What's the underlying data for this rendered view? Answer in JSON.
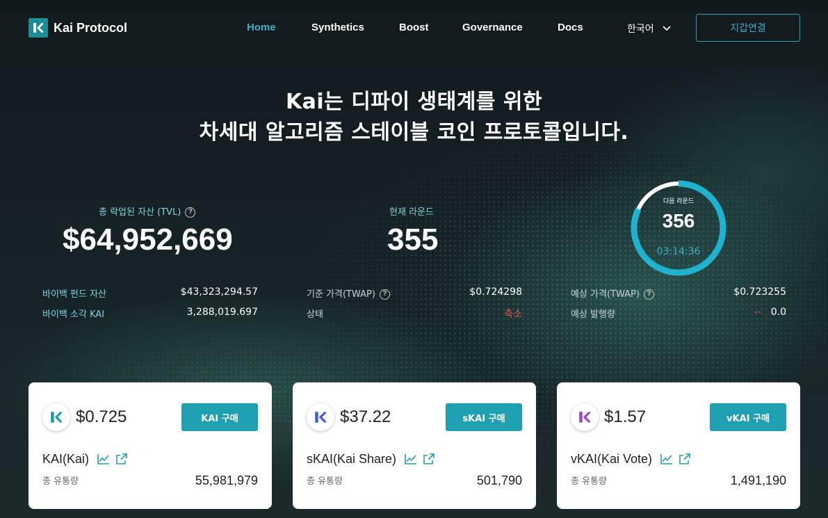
{
  "header": {
    "brand": "Kai Protocol",
    "nav": [
      "Home",
      "Synthetics",
      "Boost",
      "Governance",
      "Docs"
    ],
    "active_nav": "Home",
    "language": "한국어",
    "connect_label": "지갑연결"
  },
  "hero": {
    "line1": "Kai는 디파이 생태계를 위한",
    "line2": "차세대 알고리즘 스테이블 코인 프로토콜입니다."
  },
  "stats": {
    "tvl_label": "총 락업된 자산 (TVL)",
    "tvl_value": "$64,952,669",
    "round_label": "현재 라운드",
    "round_value": "355",
    "next_round_label": "다음 라운드",
    "next_round_value": "356",
    "next_round_timer": "03:14:36",
    "next_round_progress": 0.82
  },
  "details": {
    "buyback_fund_label": "바이백 펀드 자산",
    "buyback_fund_value": "$43,323,294.57",
    "buyback_burn_label": "바이백 소각 KAI",
    "buyback_burn_value": "3,288,019.697",
    "twap_label": "기준 가격(TWAP)",
    "twap_value": "$0.724298",
    "status_label": "상태",
    "status_value": "축소",
    "est_twap_label": "예상 가격(TWAP)",
    "est_twap_value": "$0.723255",
    "est_issue_label": "예상 발행량",
    "est_issue_dash": "--",
    "est_issue_value": "0.0"
  },
  "cards": [
    {
      "price": "$0.725",
      "buy_label": "KAI 구매",
      "name": "KAI(Kai)",
      "supply_label": "총 유통량",
      "supply": "55,981,979",
      "color": "#1c9aa8"
    },
    {
      "price": "$37.22",
      "buy_label": "sKAI 구매",
      "name": "sKAI(Kai Share)",
      "supply_label": "총 유통량",
      "supply": "501,790",
      "color": "#3d5ae0"
    },
    {
      "price": "$1.57",
      "buy_label": "vKAI 구매",
      "name": "vKAI(Kai Vote)",
      "supply_label": "총 유통량",
      "supply": "1,491,190",
      "color": "#9b3fd6"
    }
  ]
}
